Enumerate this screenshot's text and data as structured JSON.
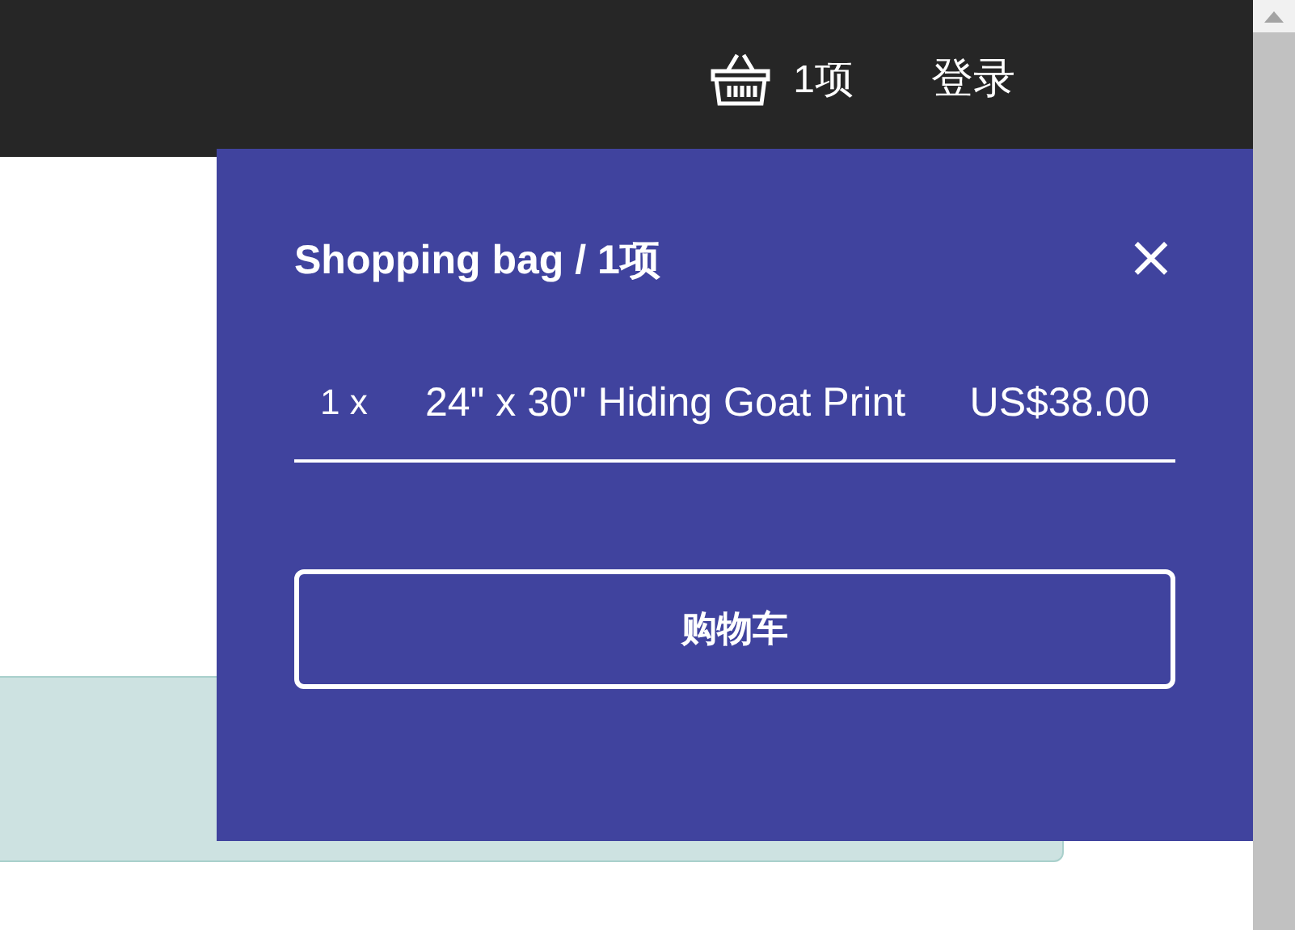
{
  "header": {
    "cart_count": "1项",
    "login": "登录"
  },
  "bag": {
    "title": "Shopping bag / 1项",
    "close": "×",
    "items": [
      {
        "quantity": "1 x",
        "name": "24\" x 30\" Hiding Goat Print",
        "price": "US$38.00"
      }
    ],
    "cart_button": "购物车"
  }
}
